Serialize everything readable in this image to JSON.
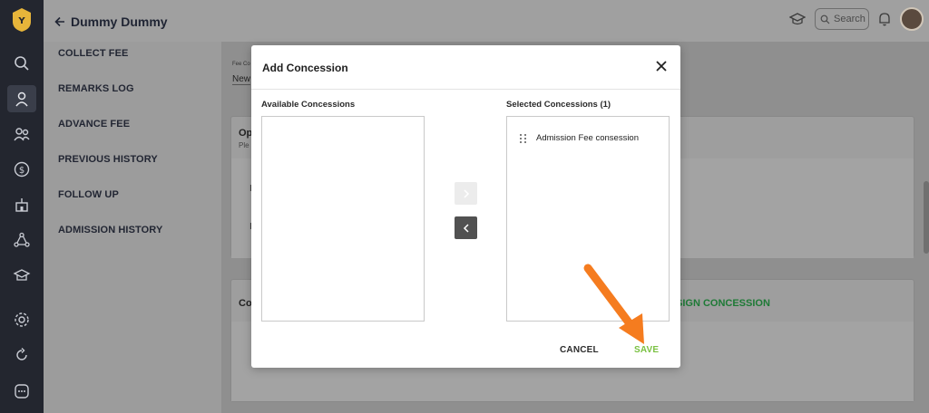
{
  "header": {
    "title": "Dummy Dummy",
    "search_placeholder": "Search"
  },
  "menu": {
    "items": [
      "COLLECT FEE",
      "REMARKS LOG",
      "ADVANCE FEE",
      "PREVIOUS HISTORY",
      "FOLLOW UP",
      "ADMISSION HISTORY"
    ]
  },
  "background": {
    "fee_label": "Fee Co",
    "fee_value": "New",
    "card1_title": "Op",
    "card1_sub": "Ple",
    "row_a": "I",
    "row_b": "I",
    "card2_title": "Co",
    "assign_link": "SIGN CONCESSION"
  },
  "modal": {
    "title": "Add Concession",
    "available_label": "Available Concessions",
    "selected_label": "Selected Concessions (1)",
    "selected_items": [
      "Admission Fee consession"
    ],
    "cancel_label": "CANCEL",
    "save_label": "SAVE"
  },
  "colors": {
    "save": "#7ac142",
    "assign_link": "#1e7a36",
    "annotation_arrow": "#f57c1f",
    "rail_bg": "#23262f"
  },
  "icons": [
    "logo-icon",
    "search-icon",
    "student-icon",
    "people-icon",
    "dollar-icon",
    "building-icon",
    "network-icon",
    "school-icon",
    "gear-icon",
    "refresh-icon",
    "chat-icon",
    "graduation-cap-icon",
    "bell-icon",
    "close-icon",
    "chevron-right-icon",
    "chevron-left-icon",
    "drag-handle-icon",
    "arrow-left-icon"
  ]
}
